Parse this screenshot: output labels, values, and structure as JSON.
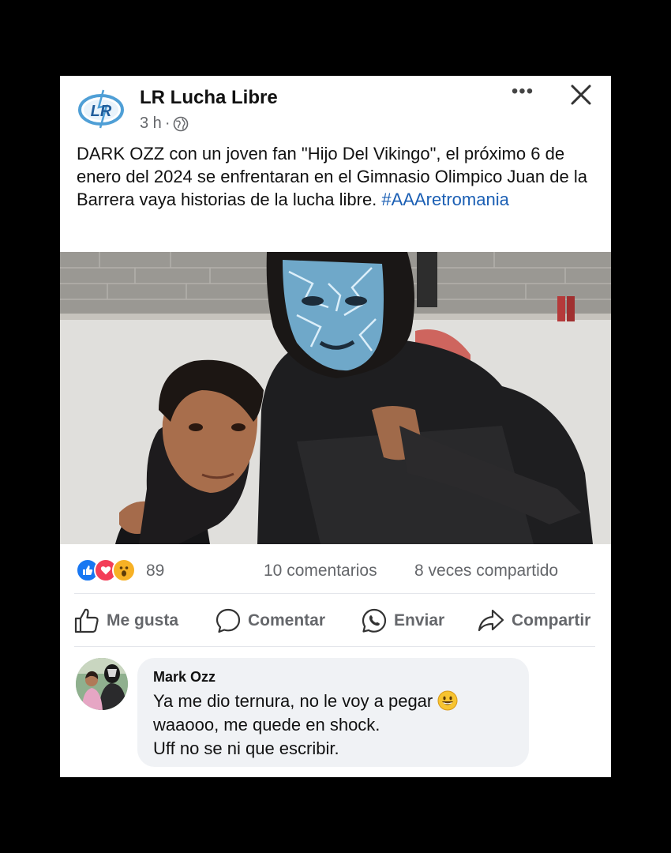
{
  "post": {
    "page_name": "LR Lucha Libre",
    "logo_text": "LR",
    "time": "3 h",
    "separator": "·",
    "privacy_icon": "globe-icon",
    "more_icon": "more-options-icon",
    "close_icon": "close-icon",
    "text": "DARK OZZ con un joven fan \"Hijo Del Vikingo\", el próximo 6 de enero del 2024 se enfrentaran en el Gimnasio Olimpico Juan de la Barrera vaya historias de la lucha libre.",
    "hashtag": "#AAAretromania"
  },
  "stats": {
    "reaction_icons": [
      "like-reaction-icon",
      "love-reaction-icon",
      "wow-reaction-icon"
    ],
    "reactions_count": "89",
    "comments": "10 comentarios",
    "shares": "8 veces compartido"
  },
  "actions": {
    "like": "Me gusta",
    "comment": "Comentar",
    "send": "Enviar",
    "share": "Compartir"
  },
  "comment": {
    "author": "Mark Ozz",
    "lines": [
      "Ya me dio ternura, no le voy a pegar",
      "waaooo, me quede en shock.",
      "Uff no se ni que escribir."
    ],
    "emoji": "grinning-face-emoji"
  },
  "colors": {
    "background": "#000000",
    "card": "#ffffff",
    "hashtag": "#1b5fb4",
    "secondary_text": "#65676b",
    "like_blue": "#1877f2",
    "love_red": "#f33e58",
    "wow_yellow": "#f7b125",
    "bubble": "#f0f2f5"
  }
}
